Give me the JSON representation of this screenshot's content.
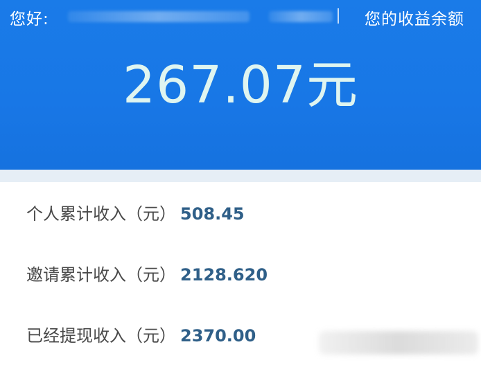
{
  "header": {
    "greeting": "您好:",
    "balance_label": "您的收益余额",
    "balance_amount": "267.07元",
    "colors": {
      "header_blue": "#1877e6",
      "amount_text": "#dff5f0"
    }
  },
  "stats": {
    "rows": [
      {
        "label": "个人累计收入（元）",
        "value": "508.45"
      },
      {
        "label": "邀请累计收入（元）",
        "value": "2128.620"
      },
      {
        "label": "已经提现收入（元）",
        "value": "2370.00"
      }
    ],
    "colors": {
      "label_text": "#4a4a4a",
      "value_text": "#2f5f88"
    }
  }
}
